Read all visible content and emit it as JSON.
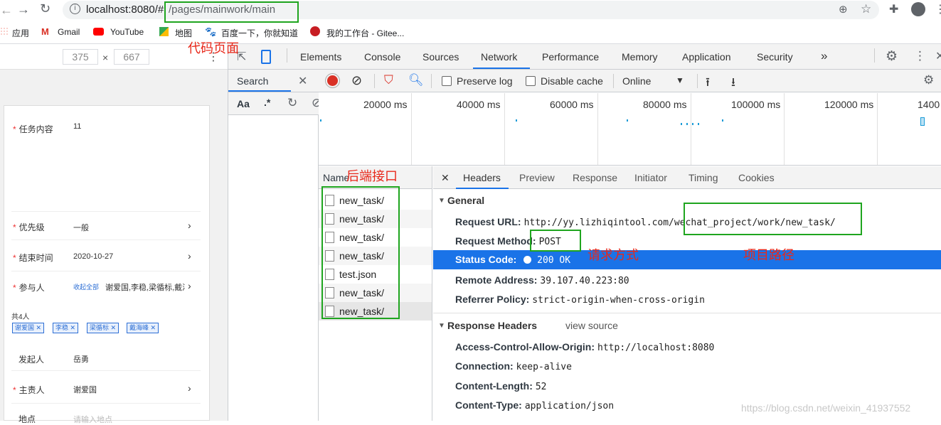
{
  "browser": {
    "url_host": "localhost:8080/#",
    "url_path": "/pages/mainwork/main",
    "bookmarks": [
      {
        "label": "应用"
      },
      {
        "label": "Gmail"
      },
      {
        "label": "YouTube"
      },
      {
        "label": "地图"
      },
      {
        "label": "百度一下，你就知道"
      },
      {
        "label": "我的工作台 - Gitee..."
      }
    ]
  },
  "device_toolbar": {
    "width": "375",
    "height": "667",
    "times": "×"
  },
  "form": {
    "fields": [
      {
        "label": "任务内容",
        "value": "11",
        "required": true
      },
      {
        "label": "优先级",
        "value": "一般",
        "required": true
      },
      {
        "label": "结束时间",
        "value": "2020-10-27",
        "required": true
      },
      {
        "label": "参与人",
        "value": "谢爱国,李稳,梁循标,戴洋",
        "link": "收起全部",
        "required": true
      },
      {
        "label": "发起人",
        "value": "岳勇",
        "required": false
      },
      {
        "label": "主责人",
        "value": "谢爱国",
        "required": true
      },
      {
        "label": "地点",
        "value": "请输入地点",
        "required": false
      }
    ],
    "participants_count": "共4人",
    "tags": [
      "谢爱国",
      "李稳",
      "梁循标",
      "戴海峰"
    ]
  },
  "devtools": {
    "tabs": [
      "Elements",
      "Console",
      "Sources",
      "Network",
      "Performance",
      "Memory",
      "Application",
      "Security"
    ],
    "more": "»",
    "search_label": "Search",
    "search_opts": {
      "case": "Aa",
      "regex": ".*"
    },
    "toolbar": {
      "preserve_log": "Preserve log",
      "disable_cache": "Disable cache",
      "throttle": "Online"
    },
    "overview_ticks": [
      "20000 ms",
      "40000 ms",
      "60000 ms",
      "80000 ms",
      "100000 ms",
      "120000 ms",
      "1400"
    ],
    "name_header": "Name",
    "requests": [
      "new_task/",
      "new_task/",
      "new_task/",
      "new_task/",
      "test.json",
      "new_task/",
      "new_task/"
    ],
    "detail_tabs": [
      "Headers",
      "Preview",
      "Response",
      "Initiator",
      "Timing",
      "Cookies"
    ],
    "close_glyph": "✕",
    "general_title": "General",
    "general": {
      "request_url_key": "Request URL:",
      "request_url_val": "http://yy.lizhiqintool.com/wechat_project/work/new_task/",
      "method_key": "Request Method:",
      "method_val": "POST",
      "status_key": "Status Code:",
      "status_val": "200 OK",
      "remote_key": "Remote Address:",
      "remote_val": "39.107.40.223:80",
      "referrer_key": "Referrer Policy:",
      "referrer_val": "strict-origin-when-cross-origin"
    },
    "response_title": "Response Headers",
    "view_source": "view source",
    "response_headers": [
      {
        "key": "Access-Control-Allow-Origin:",
        "val": "http://localhost:8080"
      },
      {
        "key": "Connection:",
        "val": "keep-alive"
      },
      {
        "key": "Content-Length:",
        "val": "52"
      },
      {
        "key": "Content-Type:",
        "val": "application/json"
      }
    ]
  },
  "annotations": {
    "page_code": "代码页面",
    "backend_api": "后端接口",
    "request_method": "请求方式",
    "project_path": "项目路径"
  },
  "watermark": "https://blog.csdn.net/weixin_41937552",
  "colors": {
    "accent": "#1a73e8",
    "annotation_box": "#1fa51f",
    "annotation_text": "#e8281a",
    "record": "#d93025"
  }
}
